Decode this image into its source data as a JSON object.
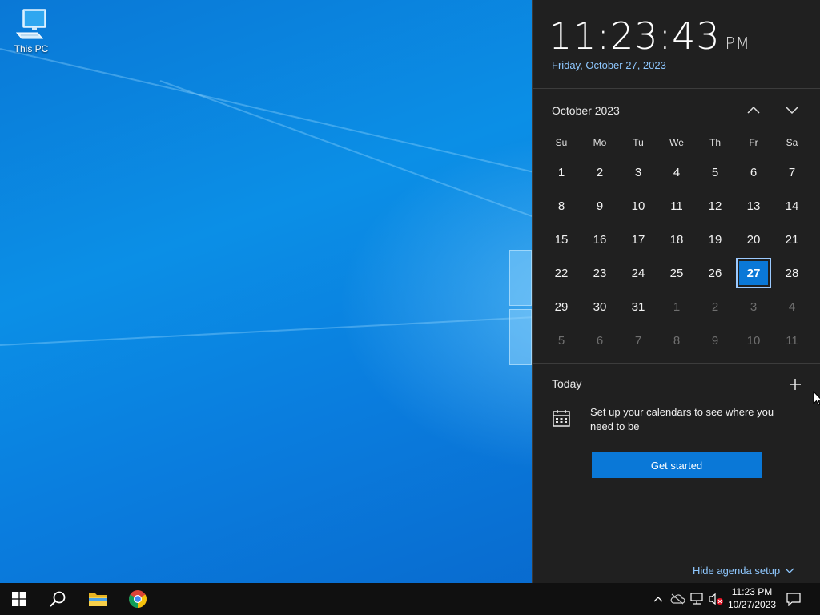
{
  "desktop": {
    "icons": [
      {
        "label": "This PC",
        "icon": "this-pc-icon"
      }
    ]
  },
  "flyout": {
    "time": "11:23:43",
    "ampm": "PM",
    "long_date": "Friday, October 27, 2023",
    "month_label": "October 2023",
    "weekdays": [
      "Su",
      "Mo",
      "Tu",
      "We",
      "Th",
      "Fr",
      "Sa"
    ],
    "weeks": [
      [
        {
          "d": "1"
        },
        {
          "d": "2"
        },
        {
          "d": "3"
        },
        {
          "d": "4"
        },
        {
          "d": "5"
        },
        {
          "d": "6"
        },
        {
          "d": "7"
        }
      ],
      [
        {
          "d": "8"
        },
        {
          "d": "9"
        },
        {
          "d": "10"
        },
        {
          "d": "11"
        },
        {
          "d": "12"
        },
        {
          "d": "13"
        },
        {
          "d": "14"
        }
      ],
      [
        {
          "d": "15"
        },
        {
          "d": "16"
        },
        {
          "d": "17"
        },
        {
          "d": "18"
        },
        {
          "d": "19"
        },
        {
          "d": "20"
        },
        {
          "d": "21"
        }
      ],
      [
        {
          "d": "22"
        },
        {
          "d": "23"
        },
        {
          "d": "24"
        },
        {
          "d": "25"
        },
        {
          "d": "26"
        },
        {
          "d": "27",
          "today": true
        },
        {
          "d": "28"
        }
      ],
      [
        {
          "d": "29"
        },
        {
          "d": "30"
        },
        {
          "d": "31"
        },
        {
          "d": "1",
          "other": true
        },
        {
          "d": "2",
          "other": true
        },
        {
          "d": "3",
          "other": true
        },
        {
          "d": "4",
          "other": true
        }
      ],
      [
        {
          "d": "5",
          "other": true
        },
        {
          "d": "6",
          "other": true
        },
        {
          "d": "7",
          "other": true
        },
        {
          "d": "8",
          "other": true
        },
        {
          "d": "9",
          "other": true
        },
        {
          "d": "10",
          "other": true
        },
        {
          "d": "11",
          "other": true
        }
      ]
    ],
    "agenda": {
      "today_label": "Today",
      "setup_text": "Set up your calendars to see where you need to be",
      "get_started_label": "Get started",
      "hide_agenda_label": "Hide agenda setup"
    }
  },
  "taskbar": {
    "pinned": [
      "start-icon",
      "search-icon",
      "file-explorer-icon",
      "chrome-icon"
    ],
    "tray": {
      "time": "11:23 PM",
      "date": "10/27/2023"
    }
  },
  "colors": {
    "accent": "#0a78d7",
    "flyout_bg": "#202020",
    "link": "#8fc8ff",
    "taskbar_bg": "#101010"
  }
}
